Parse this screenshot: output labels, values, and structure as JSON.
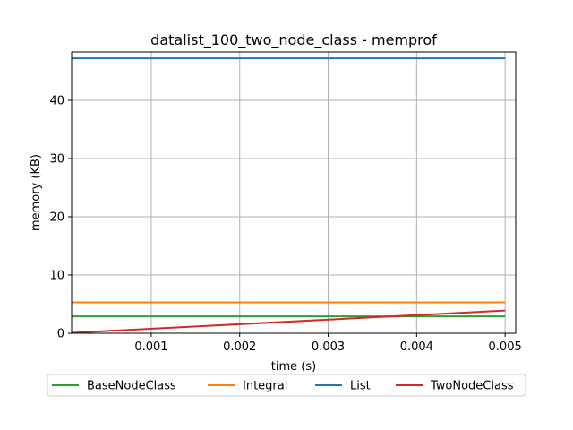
{
  "chart_data": {
    "type": "line",
    "title": "datalist_100_two_node_class - memprof",
    "xlabel": "time (s)",
    "ylabel": "memory (KB)",
    "xlim": [
      0.0001,
      0.00512
    ],
    "ylim": [
      0,
      48.3
    ],
    "xticks": [
      0.001,
      0.002,
      0.003,
      0.004,
      0.005
    ],
    "xtick_labels": [
      "0.001",
      "0.002",
      "0.003",
      "0.004",
      "0.005"
    ],
    "yticks": [
      0,
      10,
      20,
      30,
      40
    ],
    "ytick_labels": [
      "0",
      "10",
      "20",
      "30",
      "40"
    ],
    "grid": true,
    "legend_placement": "below plot, 4 columns",
    "series": [
      {
        "name": "BaseNodeClass",
        "color": "#2ca02c",
        "x": [
          0.0,
          0.005
        ],
        "y": [
          2.9,
          2.9
        ]
      },
      {
        "name": "Integral",
        "color": "#ff7f0e",
        "x": [
          0.0,
          0.005
        ],
        "y": [
          5.3,
          5.3
        ]
      },
      {
        "name": "List",
        "color": "#1f77b4",
        "x": [
          0.0,
          0.005
        ],
        "y": [
          47.2,
          47.2
        ]
      },
      {
        "name": "TwoNodeClass",
        "color": "#d62728",
        "x": [
          0.0,
          0.005
        ],
        "y": [
          0.0,
          3.9
        ]
      }
    ]
  }
}
